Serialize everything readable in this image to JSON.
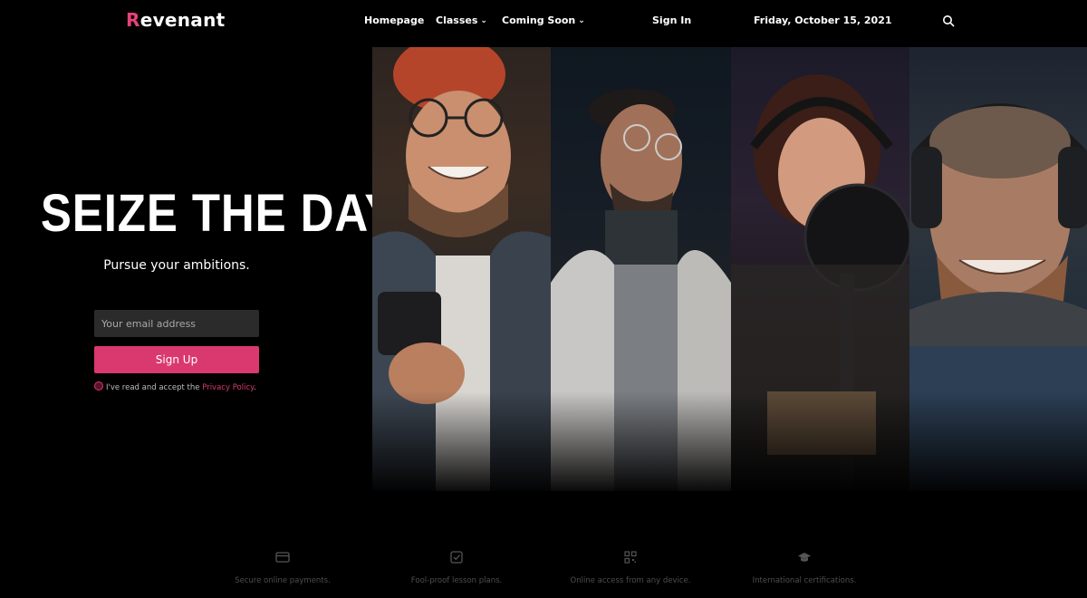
{
  "brand": {
    "name_first": "R",
    "name_rest": "evenant",
    "accent": "#d9396f"
  },
  "nav": {
    "homepage": "Homepage",
    "classes": "Classes",
    "coming_soon": "Coming Soon",
    "sign_in": "Sign In",
    "date": "Friday, October 15, 2021",
    "search_icon": "search-icon"
  },
  "hero": {
    "title": "SEIZE THE DAY",
    "subtitle": "Pursue your ambitions.",
    "email_placeholder": "Your email address",
    "signup_label": "Sign Up",
    "policy_text": "I've read and accept the ",
    "policy_link": "Privacy Policy",
    "policy_end": "."
  },
  "features": [
    {
      "icon": "credit-card-icon",
      "text": "Secure online payments."
    },
    {
      "icon": "checkbox-icon",
      "text": "Fool-proof lesson plans."
    },
    {
      "icon": "qr-code-icon",
      "text": "Online access from any device."
    },
    {
      "icon": "graduation-cap-icon",
      "text": "International certifications."
    }
  ]
}
